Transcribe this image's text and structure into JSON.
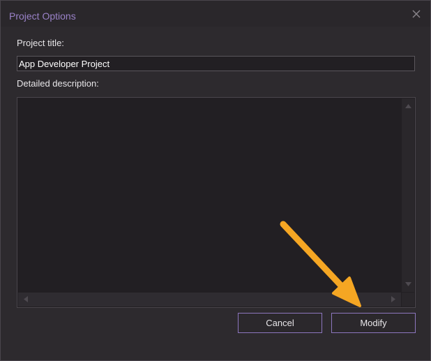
{
  "dialog": {
    "title": "Project Options",
    "title_color": "#9a82c8",
    "close_icon": "close-icon"
  },
  "form": {
    "project_title_label": "Project title:",
    "project_title_value": "App Developer Project",
    "description_label": "Detailed description:",
    "description_value": ""
  },
  "buttons": {
    "cancel_label": "Cancel",
    "modify_label": "Modify",
    "border_color": "#8d76bf"
  },
  "annotation": {
    "pointer_color": "#f5a623",
    "pointer_icon": "arrow-pointer-icon"
  }
}
